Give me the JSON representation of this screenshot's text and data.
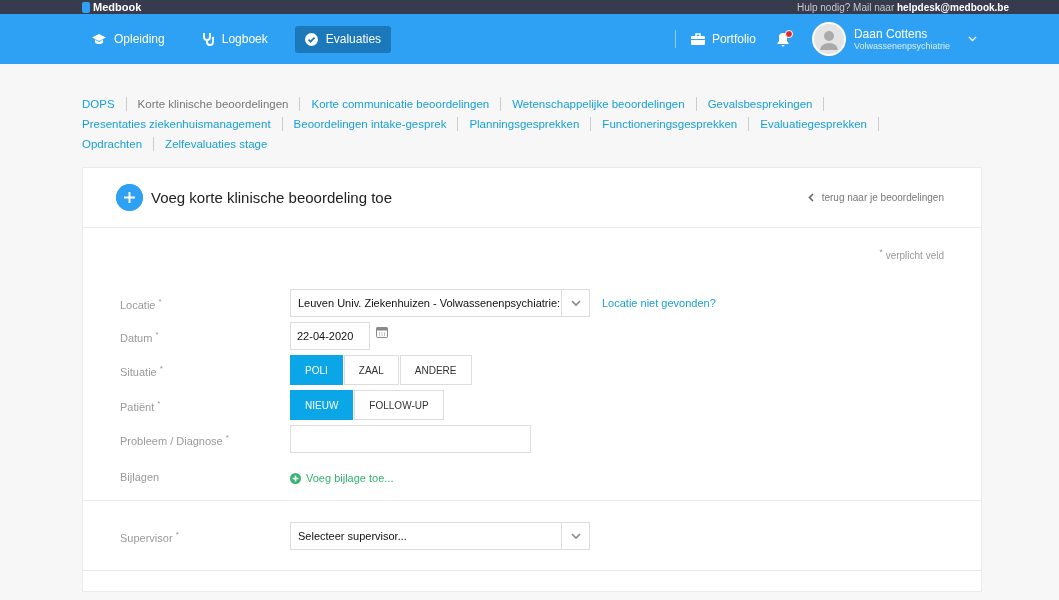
{
  "topbar": {
    "logo": "Medbook",
    "help_text": "Hulp nodig? Mail naar",
    "help_email": "helpdesk@medbook.be"
  },
  "nav": {
    "items": [
      {
        "label": "Opleiding",
        "selected": false
      },
      {
        "label": "Logboek",
        "selected": false
      },
      {
        "label": "Evaluaties",
        "selected": true
      }
    ],
    "portfolio": "Portfolio",
    "notifications_unread": true,
    "user": {
      "name": "Daan Cottens",
      "role": "Volwassenenpsychiatrie"
    }
  },
  "subnav": [
    {
      "label": "DOPS",
      "selected": false
    },
    {
      "label": "Korte klinische beoordelingen",
      "selected": true
    },
    {
      "label": "Korte communicatie beoordelingen",
      "selected": false
    },
    {
      "label": "Wetenschappelijke beoordelingen",
      "selected": false
    },
    {
      "label": "Gevalsbesprekingen",
      "selected": false
    },
    {
      "label": "Presentaties ziekenhuismanagement",
      "selected": false
    },
    {
      "label": "Beoordelingen intake-gesprek",
      "selected": false
    },
    {
      "label": "Planningsgesprekken",
      "selected": false
    },
    {
      "label": "Functioneringsgesprekken",
      "selected": false
    },
    {
      "label": "Evaluatiegesprekken",
      "selected": false
    },
    {
      "label": "Opdrachten",
      "selected": false
    },
    {
      "label": "Zelfevaluaties stage",
      "selected": false
    }
  ],
  "card": {
    "title": "Voeg korte klinische beoordeling toe",
    "back_link": "terug naar je beoordelingen",
    "required_note": "$^{*}$ verplicht veld",
    "fields": [
      {
        "label": "Locatie $^{*}$",
        "kind": "select",
        "value": "Leuven Univ. Ziekenhuizen - Volwassenenpsychiatrie:",
        "link": "Locatie niet gevonden?"
      },
      {
        "label": "Datum $^{*}$",
        "kind": "date",
        "value": "22-04-2020"
      },
      {
        "label": "Situatie $^{*}$",
        "kind": "segmented",
        "options": [
          {
            "label": "POLI",
            "selected": true
          },
          {
            "label": "ZAAL",
            "selected": false
          },
          {
            "label": "ANDERE",
            "selected": false
          }
        ]
      },
      {
        "label": "Patiënt $^{*}$",
        "kind": "segmented",
        "options": [
          {
            "label": "NIEUW",
            "selected": true
          },
          {
            "label": "FOLLOW-UP",
            "selected": false
          }
        ]
      },
      {
        "label": "Probleem / Diagnose $^{*}$",
        "kind": "text"
      },
      {
        "label": "Bijlagen",
        "kind": "add",
        "link": "Voeg bijlage toe..."
      }
    ],
    "supervisor": {
      "label": "Supervisor  $^{*}$",
      "value": "Selecteer supervisor..."
    }
  }
}
